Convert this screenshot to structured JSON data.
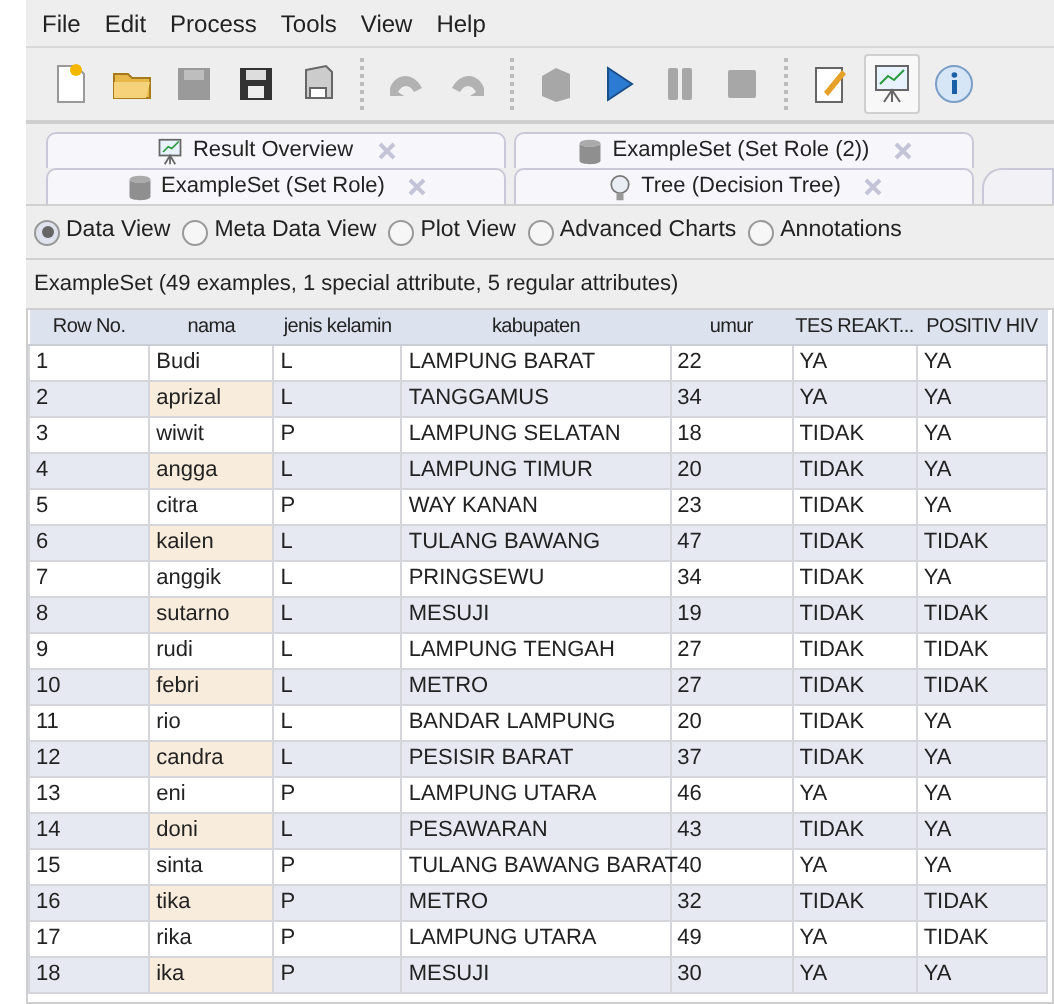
{
  "menu": [
    "File",
    "Edit",
    "Process",
    "Tools",
    "View",
    "Help"
  ],
  "toolbar": [
    {
      "kind": "new",
      "disabled": false,
      "selected": false
    },
    {
      "kind": "open",
      "disabled": false,
      "selected": false
    },
    {
      "kind": "save",
      "disabled": true,
      "selected": false
    },
    {
      "kind": "saveas",
      "disabled": false,
      "selected": false
    },
    {
      "kind": "print",
      "disabled": false,
      "selected": false
    },
    {
      "kind": "sep"
    },
    {
      "kind": "undo",
      "disabled": true,
      "selected": false
    },
    {
      "kind": "redo",
      "disabled": true,
      "selected": false
    },
    {
      "kind": "sep"
    },
    {
      "kind": "block",
      "disabled": true,
      "selected": false
    },
    {
      "kind": "run",
      "disabled": false,
      "selected": false
    },
    {
      "kind": "pause",
      "disabled": true,
      "selected": false
    },
    {
      "kind": "stop",
      "disabled": true,
      "selected": false
    },
    {
      "kind": "sep"
    },
    {
      "kind": "notes",
      "disabled": false,
      "selected": false
    },
    {
      "kind": "results",
      "disabled": false,
      "selected": true
    },
    {
      "kind": "info",
      "disabled": false,
      "selected": false
    }
  ],
  "tab_rows": [
    [
      {
        "label": "Result Overview",
        "kind": "chart"
      },
      {
        "label": "ExampleSet (Set Role (2))",
        "kind": "db"
      }
    ],
    [
      {
        "label": "ExampleSet (Set Role)",
        "kind": "db"
      },
      {
        "label": "Tree (Decision Tree)",
        "kind": "bulb"
      }
    ]
  ],
  "views": [
    {
      "label": "Data View",
      "selected": true
    },
    {
      "label": "Meta Data View",
      "selected": false
    },
    {
      "label": "Plot View",
      "selected": false
    },
    {
      "label": "Advanced Charts",
      "selected": false
    },
    {
      "label": "Annotations",
      "selected": false
    }
  ],
  "summary": "ExampleSet (49 examples, 1 special attribute, 5 regular attributes)",
  "table": {
    "columns": [
      "Row No.",
      "nama",
      "jenis kelamin",
      "kabupaten",
      "umur",
      "TES REAKT...",
      "POSITIV HIV"
    ],
    "rows": [
      [
        "1",
        "Budi",
        "L",
        "LAMPUNG BARAT",
        "22",
        "YA",
        "YA"
      ],
      [
        "2",
        "aprizal",
        "L",
        "TANGGAMUS",
        "34",
        "YA",
        "YA"
      ],
      [
        "3",
        "wiwit",
        "P",
        "LAMPUNG SELATAN",
        "18",
        "TIDAK",
        "YA"
      ],
      [
        "4",
        "angga",
        "L",
        "LAMPUNG TIMUR",
        "20",
        "TIDAK",
        "YA"
      ],
      [
        "5",
        "citra",
        "P",
        "WAY KANAN",
        "23",
        "TIDAK",
        "YA"
      ],
      [
        "6",
        "kailen",
        "L",
        "TULANG BAWANG",
        "47",
        "TIDAK",
        "TIDAK"
      ],
      [
        "7",
        "anggik",
        "L",
        "PRINGSEWU",
        "34",
        "TIDAK",
        "YA"
      ],
      [
        "8",
        "sutarno",
        "L",
        "MESUJI",
        "19",
        "TIDAK",
        "TIDAK"
      ],
      [
        "9",
        "rudi",
        "L",
        "LAMPUNG TENGAH",
        "27",
        "TIDAK",
        "TIDAK"
      ],
      [
        "10",
        "febri",
        "L",
        "METRO",
        "27",
        "TIDAK",
        "TIDAK"
      ],
      [
        "11",
        "rio",
        "L",
        "BANDAR LAMPUNG",
        "20",
        "TIDAK",
        "YA"
      ],
      [
        "12",
        "candra",
        "L",
        "PESISIR BARAT",
        "37",
        "TIDAK",
        "YA"
      ],
      [
        "13",
        "eni",
        "P",
        "LAMPUNG UTARA",
        "46",
        "YA",
        "YA"
      ],
      [
        "14",
        "doni",
        "L",
        "PESAWARAN",
        "43",
        "TIDAK",
        "YA"
      ],
      [
        "15",
        "sinta",
        "P",
        "TULANG BAWANG BARAT",
        "40",
        "YA",
        "YA"
      ],
      [
        "16",
        "tika",
        "P",
        "METRO",
        "32",
        "TIDAK",
        "TIDAK"
      ],
      [
        "17",
        "rika",
        "P",
        "LAMPUNG UTARA",
        "49",
        "YA",
        "TIDAK"
      ],
      [
        "18",
        "ika",
        "P",
        "MESUJI",
        "30",
        "YA",
        "YA"
      ]
    ]
  }
}
